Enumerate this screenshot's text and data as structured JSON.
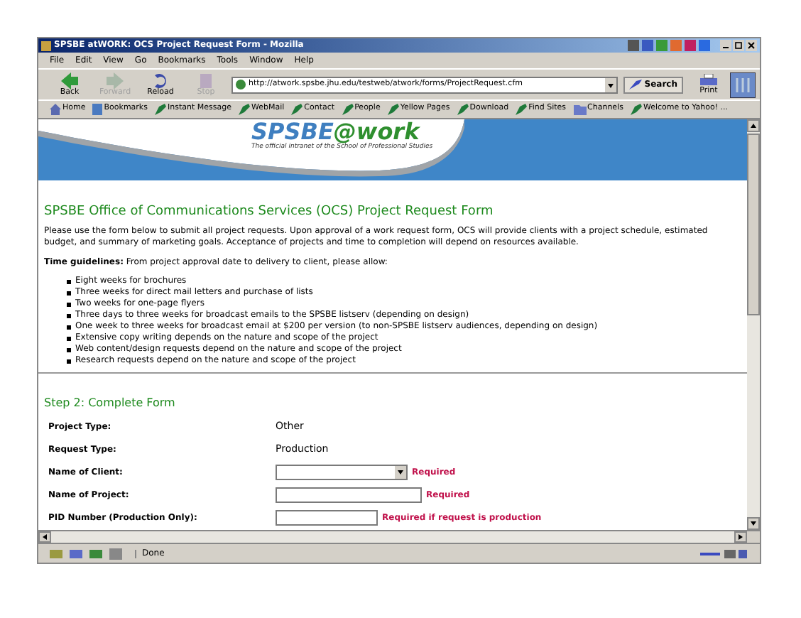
{
  "window": {
    "title": "SPSBE atWORK: OCS Project Request Form - Mozilla"
  },
  "menu": [
    "File",
    "Edit",
    "View",
    "Go",
    "Bookmarks",
    "Tools",
    "Window",
    "Help"
  ],
  "toolbar": [
    {
      "label": "Back",
      "kind": "back",
      "disabled": false
    },
    {
      "label": "Forward",
      "kind": "forward",
      "disabled": true
    },
    {
      "label": "Reload",
      "kind": "reload",
      "disabled": false
    },
    {
      "label": "Stop",
      "kind": "stop",
      "disabled": true
    }
  ],
  "address": {
    "value": "http://atwork.spsbe.jhu.edu/testweb/atwork/forms/ProjectRequest.cfm"
  },
  "search_button": "Search",
  "print_button": "Print",
  "bookmarks": [
    {
      "label": "Home",
      "kind": "home"
    },
    {
      "label": "Bookmarks",
      "kind": "bookmarks"
    },
    {
      "label": "Instant Message",
      "kind": "link"
    },
    {
      "label": "WebMail",
      "kind": "link"
    },
    {
      "label": "Contact",
      "kind": "link"
    },
    {
      "label": "People",
      "kind": "link"
    },
    {
      "label": "Yellow Pages",
      "kind": "link"
    },
    {
      "label": "Download",
      "kind": "link"
    },
    {
      "label": "Find Sites",
      "kind": "link"
    },
    {
      "label": "Channels",
      "kind": "channels"
    },
    {
      "label": "Welcome to Yahoo! ...",
      "kind": "link"
    }
  ],
  "banner": {
    "logo_left": "SPSBE",
    "logo_right": "@work",
    "tagline": "The official intranet of the School of Professional Studies"
  },
  "page": {
    "heading": "SPSBE Office of Communications Services (OCS) Project Request Form",
    "intro": "Please use the form below to submit all project requests. Upon approval of a work request form, OCS will provide clients with a project schedule, estimated budget, and summary of marketing goals. Acceptance of projects and time to completion will depend on resources available.",
    "guidelines": "**Time guidelines:** From project approval date to delivery to client, please allow:",
    "list": [
      "Eight weeks for brochures",
      "Three weeks for direct mail letters and purchase of lists",
      "Two weeks for one-page flyers",
      "Three days to three weeks for broadcast emails to the SPSBE listserv (depending on design)",
      "One week to three weeks for broadcast email at $200 per version (to non-SPSBE listserv audiences, depending on design)",
      "Extensive copy writing depends on the nature and scope of the project",
      "Web content/design requests depend on the nature and scope of the project",
      "Research requests depend on the nature and scope of the project"
    ],
    "step_heading": "Step 2: Complete Form",
    "form": [
      {
        "label": "Project Type:",
        "kind": "text",
        "value": "Other"
      },
      {
        "label": "Request Type:",
        "kind": "text",
        "value": "Production"
      },
      {
        "label": "Name of Client:",
        "kind": "select",
        "note": "Required"
      },
      {
        "label": "Name of Project:",
        "kind": "input",
        "note": "Required"
      },
      {
        "label": "PID Number (Production Only):",
        "kind": "short_input",
        "note": "Required if request is production"
      }
    ]
  },
  "status_bar": {
    "text": "Done"
  }
}
